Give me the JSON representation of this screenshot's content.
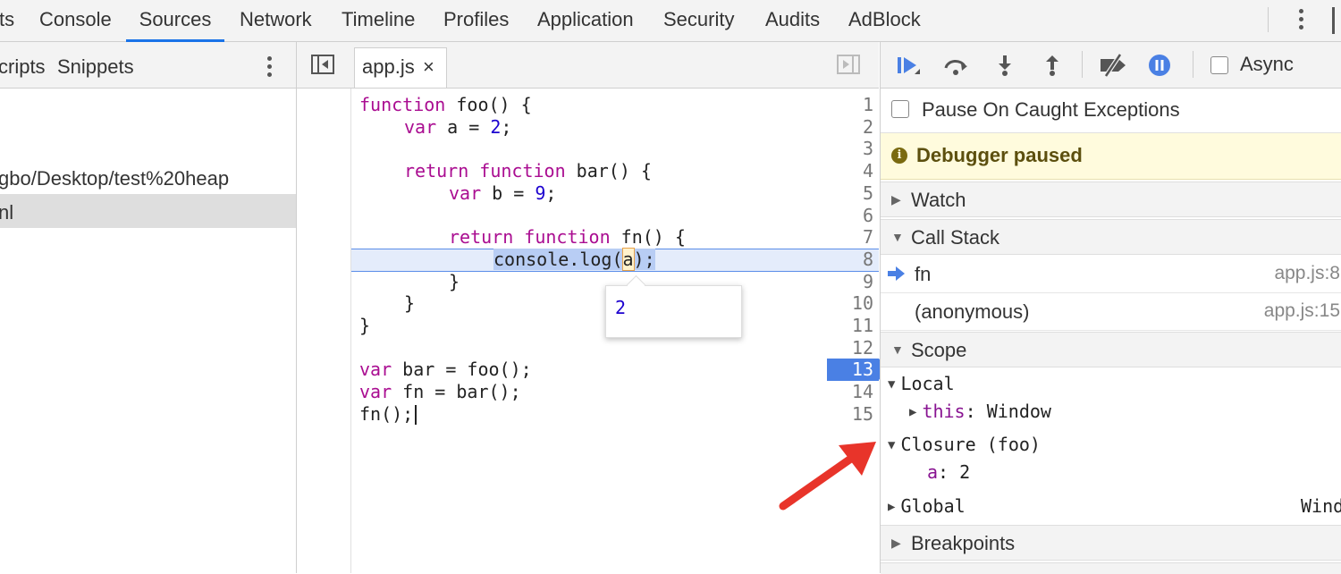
{
  "top_tabs": [
    "ts",
    "Console",
    "Sources",
    "Network",
    "Timeline",
    "Profiles",
    "Application",
    "Security",
    "Audits",
    "AdBlock"
  ],
  "active_tab": "Sources",
  "navigator": {
    "tabs": [
      "cripts",
      "Snippets"
    ],
    "tree": [
      "gbo/Desktop/test%20heap",
      "nl"
    ]
  },
  "editor": {
    "file_tab": "app.js",
    "close_glyph": "×",
    "line_numbers": [
      "1",
      "2",
      "3",
      "4",
      "5",
      "6",
      "7",
      "8",
      "9",
      "10",
      "11",
      "12",
      "13",
      "14",
      "15"
    ],
    "breakpoint_line": "13",
    "code": {
      "l1_kw": "function",
      "l1_rest": " foo() {",
      "l2_kw": "var",
      "l2_rest": " a = ",
      "l2_num": "2",
      "l2_end": ";",
      "l4_kw1": "return",
      "l4_kw2": "function",
      "l4_rest": " bar() {",
      "l5_kw": "var",
      "l5_rest": " b = ",
      "l5_num": "9",
      "l5_end": ";",
      "l7_kw1": "return",
      "l7_kw2": "function",
      "l7_rest": " fn() {",
      "l8_pre": "console.log(",
      "l8_tok": "a",
      "l8_post": ");",
      "l9": "}",
      "l10": "}",
      "l11": "}",
      "l13_kw": "var",
      "l13_rest": " bar = foo();",
      "l14_kw": "var",
      "l14_rest": " fn = bar();",
      "l15": "fn();"
    },
    "hover_value": "2"
  },
  "debugger": {
    "async_label": "Async",
    "pause_caught_label": "Pause On Caught Exceptions",
    "paused_message": "Debugger paused",
    "sections": {
      "watch": "Watch",
      "call_stack": "Call Stack",
      "scope": "Scope",
      "breakpoints": "Breakpoints"
    },
    "call_stack": [
      {
        "name": "fn",
        "location": "app.js:8"
      },
      {
        "name": "(anonymous)",
        "location": "app.js:15"
      }
    ],
    "scope": {
      "local_label": "Local",
      "this_key": "this",
      "this_val": ": Window",
      "closure_label": "Closure (foo)",
      "closure_var_key": "a",
      "closure_var_val": ": 2",
      "global_label": "Global",
      "global_val": "Wind"
    }
  },
  "colors": {
    "accent": "#1a73e8",
    "breakpoint": "#4a80e4",
    "keyword": "#aa0d91",
    "number": "#1c00cf",
    "annotation_arrow": "#e8342a",
    "paused_banner": "#fffbdd"
  }
}
